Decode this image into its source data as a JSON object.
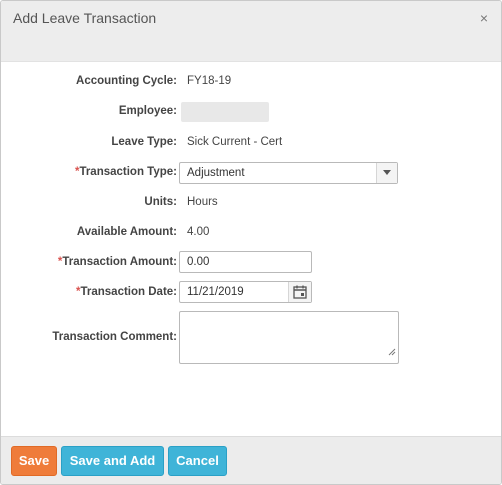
{
  "dialog": {
    "title": "Add Leave Transaction",
    "close_glyph": "×"
  },
  "form": {
    "accounting_cycle": {
      "label": "Accounting Cycle:",
      "value": "FY18-19"
    },
    "employee": {
      "label": "Employee:"
    },
    "leave_type": {
      "label": "Leave Type:",
      "value": "Sick Current - Cert"
    },
    "transaction_type": {
      "required_mark": "*",
      "label": "Transaction Type:",
      "value": "Adjustment"
    },
    "units": {
      "label": "Units:",
      "value": "Hours"
    },
    "available_amount": {
      "label": "Available Amount:",
      "value": "4.00"
    },
    "transaction_amount": {
      "required_mark": "*",
      "label": "Transaction Amount:",
      "value": "0.00"
    },
    "transaction_date": {
      "required_mark": "*",
      "label": "Transaction Date:",
      "value": "11/21/2019"
    },
    "transaction_comment": {
      "label": "Transaction Comment:",
      "value": ""
    }
  },
  "footer": {
    "save_label": "Save",
    "save_and_add_label": "Save and Add",
    "cancel_label": "Cancel"
  },
  "colors": {
    "save_button": "#ef7c3a",
    "secondary_button": "#3fb4d8",
    "required_mark": "#d9534f"
  }
}
